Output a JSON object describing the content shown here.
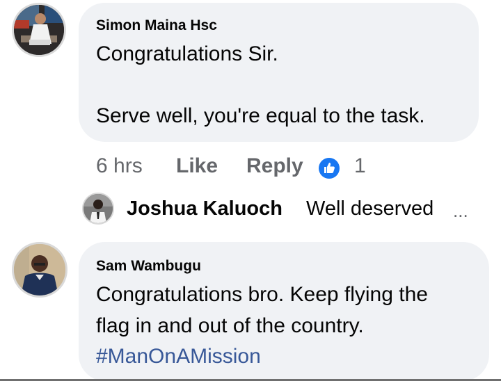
{
  "comments": [
    {
      "author": "Simon Maina Hsc",
      "lines": [
        "Congratulations Sir.",
        "",
        "Serve well, you're equal to the task."
      ],
      "time": "6 hrs",
      "like_label": "Like",
      "reply_label": "Reply",
      "reaction_count": "1",
      "reaction_icon": "thumbs-up-icon",
      "reply_preview": {
        "author": "Joshua Kaluoch",
        "text": "Well deserved",
        "ellipsis": "..."
      }
    },
    {
      "author": "Sam Wambugu",
      "lines": [
        "Congratulations bro. Keep flying the",
        "flag in and out of the country."
      ],
      "hashtag": "#ManOnAMission"
    }
  ],
  "colors": {
    "bubble": "#f0f2f5",
    "meta_text": "#65676b",
    "hashtag": "#385898",
    "reaction_blue": "#1877f2"
  }
}
